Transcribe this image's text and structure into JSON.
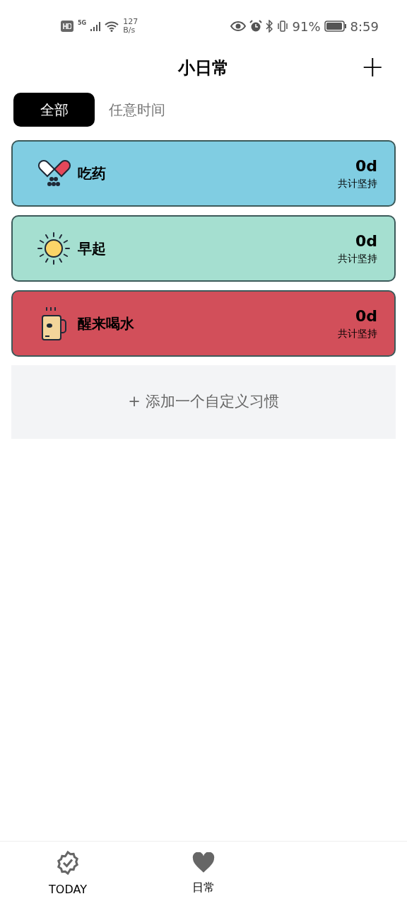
{
  "status_bar": {
    "network": "5G",
    "speed_value": "127",
    "speed_unit": "B/s",
    "battery": "91%",
    "time": "8:59"
  },
  "header": {
    "title": "小日常",
    "add": "+"
  },
  "tabs": [
    {
      "label": "全部",
      "selected": true
    },
    {
      "label": "任意时间",
      "selected": false
    }
  ],
  "habits": [
    {
      "name": "吃药",
      "count": "0d",
      "caption": "共计坚持",
      "color": "#80cde2"
    },
    {
      "name": "早起",
      "count": "0d",
      "caption": "共计坚持",
      "color": "#a5dfd0"
    },
    {
      "name": "醒来喝水",
      "count": "0d",
      "caption": "共计坚持",
      "color": "#d24f5a"
    }
  ],
  "add_habit": "+ 添加一个自定义习惯",
  "bottom_nav": [
    {
      "label": "TODAY"
    },
    {
      "label": "日常"
    }
  ]
}
